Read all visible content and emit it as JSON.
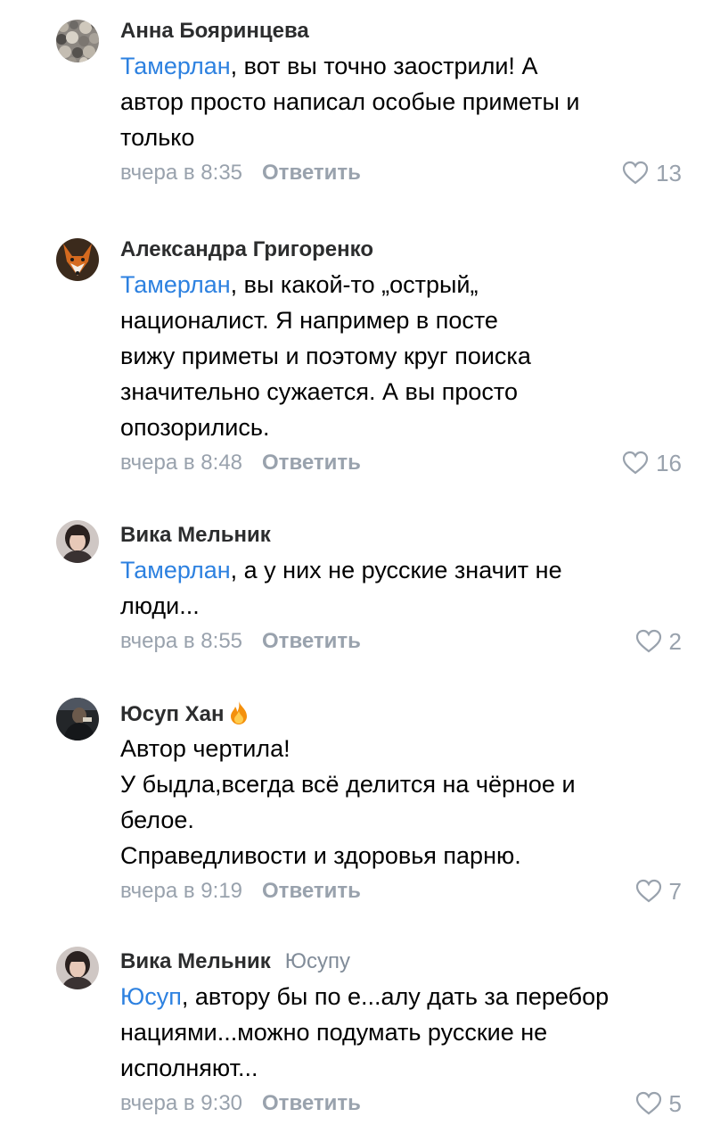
{
  "comments": [
    {
      "author": "Анна Бояринцева",
      "reply_to": "",
      "mention": "Тамерлан",
      "lines": [
        ", вот вы точно заострили! А",
        "автор просто написал особые приметы и",
        "только"
      ],
      "time": "вчера в 8:35",
      "reply_label": "Ответить",
      "likes": "13",
      "avatar_icon": "stones-avatar-icon"
    },
    {
      "author": "Александра Григоренко",
      "reply_to": "",
      "mention": "Тамерлан",
      "lines": [
        ", вы какой-то „острый„",
        "националист. Я например в посте",
        "вижу приметы и поэтому круг поиска",
        "значительно сужается. А вы просто",
        "опозорились."
      ],
      "time": "вчера в 8:48",
      "reply_label": "Ответить",
      "likes": "16",
      "avatar_icon": "fox-avatar-icon"
    },
    {
      "author": "Вика Мельник",
      "reply_to": "",
      "mention": "Тамерлан",
      "lines": [
        ", а у них не русские значит не",
        "люди..."
      ],
      "time": "вчера в 8:55",
      "reply_label": "Ответить",
      "likes": "2",
      "avatar_icon": "person-avatar-icon"
    },
    {
      "author": "Юсуп Хан",
      "reply_to": "",
      "mention": "",
      "lines": [
        "Автор чертила!",
        "У быдла,всегда всё делится на чёрное и",
        "белое.",
        "Справедливости и здоровья парню."
      ],
      "time": "вчера в 9:19",
      "reply_label": "Ответить",
      "likes": "7",
      "avatar_icon": "dark-photo-avatar-icon"
    },
    {
      "author": "Вика Мельник",
      "reply_to": "Юсупу",
      "mention": "Юсуп",
      "lines": [
        ", автору бы по е...алу дать за перебор",
        "нациями...можно подумать русские не",
        "исполняют..."
      ],
      "time": "вчера в 9:30",
      "reply_label": "Ответить",
      "likes": "5",
      "avatar_icon": "person-avatar-icon"
    }
  ],
  "colors": {
    "mention": "#2d81e0",
    "meta": "#99a2ad",
    "author": "#2c2d2e"
  }
}
